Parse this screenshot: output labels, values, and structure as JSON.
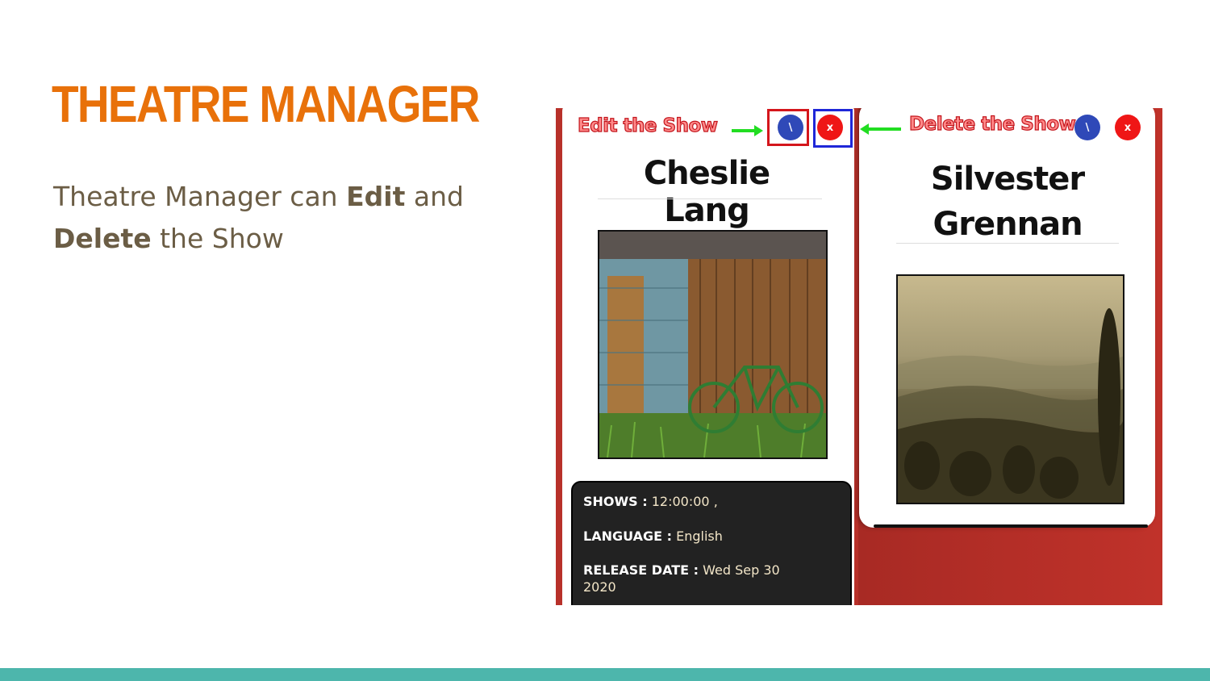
{
  "slide": {
    "title": "THEATRE MANAGER",
    "body_pre": "Theatre Manager can ",
    "body_edit": "Edit",
    "body_mid": " and",
    "body_delete": "Delete",
    "body_post": " the Show"
  },
  "annotations": {
    "edit_label": "Edit the Show",
    "delete_label": "Delete the Show",
    "edit_box_color": "#d4161c",
    "delete_box_color": "#1f27d8",
    "arrow_color": "#22dd22"
  },
  "cards": [
    {
      "name": "Cheslie Lang",
      "image": "wooden-shed-bicycle-photo",
      "details": {
        "shows_label": "SHOWS :",
        "shows_value": " 12:00:00 ,",
        "language_label": "LANGUAGE :",
        "language_value": " English",
        "release_label": "RELEASE DATE :",
        "release_value": " Wed Sep 30",
        "release_value_2": "2020"
      }
    },
    {
      "name_line1": "Silvester",
      "name_line2": "Grennan",
      "image": "misty-hills-landscape-photo"
    }
  ],
  "buttons": {
    "edit_glyph": "\\",
    "delete_glyph": "x"
  },
  "colors": {
    "title": "#e8710a",
    "accent_bar": "#4db6ac",
    "app_background": "#b8312a",
    "edit_button": "#2f49b8",
    "delete_button": "#ef1616"
  }
}
